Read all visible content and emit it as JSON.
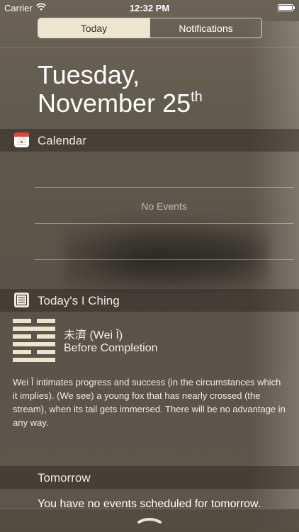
{
  "status_bar": {
    "carrier": "Carrier",
    "time": "12:32 PM"
  },
  "tabs": [
    {
      "label": "Today",
      "selected": true
    },
    {
      "label": "Notifications",
      "selected": false
    }
  ],
  "date": {
    "weekday": "Tuesday,",
    "month_day": "November 25",
    "suffix": "th"
  },
  "calendar": {
    "title": "Calendar",
    "empty_text": "No Events"
  },
  "iching": {
    "title": "Today's I Ching",
    "hexagram_name": "未濟 (Wei Ǐ)",
    "hexagram_meaning": "Before Completion",
    "description": "Wei Ǐ intimates progress and success (in the circumstances which it implies). (We see) a young fox that has nearly crossed (the stream), when its tail gets immersed. There will be no advantage in any way."
  },
  "tomorrow": {
    "title": "Tomorrow",
    "text": "You have no events scheduled for tomorrow."
  },
  "colors": {
    "background": "#5e574b",
    "segment_active": "#ece5cf",
    "hexagram_lines": "#ece4cd"
  }
}
